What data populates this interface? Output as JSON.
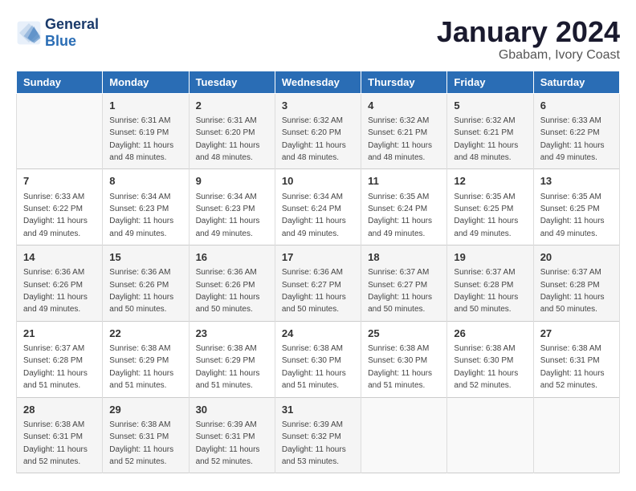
{
  "header": {
    "logo_line1": "General",
    "logo_line2": "Blue",
    "title": "January 2024",
    "subtitle": "Gbabam, Ivory Coast"
  },
  "columns": [
    "Sunday",
    "Monday",
    "Tuesday",
    "Wednesday",
    "Thursday",
    "Friday",
    "Saturday"
  ],
  "weeks": [
    [
      {
        "day": "",
        "sunrise": "",
        "sunset": "",
        "daylight": ""
      },
      {
        "day": "1",
        "sunrise": "Sunrise: 6:31 AM",
        "sunset": "Sunset: 6:19 PM",
        "daylight": "Daylight: 11 hours and 48 minutes."
      },
      {
        "day": "2",
        "sunrise": "Sunrise: 6:31 AM",
        "sunset": "Sunset: 6:20 PM",
        "daylight": "Daylight: 11 hours and 48 minutes."
      },
      {
        "day": "3",
        "sunrise": "Sunrise: 6:32 AM",
        "sunset": "Sunset: 6:20 PM",
        "daylight": "Daylight: 11 hours and 48 minutes."
      },
      {
        "day": "4",
        "sunrise": "Sunrise: 6:32 AM",
        "sunset": "Sunset: 6:21 PM",
        "daylight": "Daylight: 11 hours and 48 minutes."
      },
      {
        "day": "5",
        "sunrise": "Sunrise: 6:32 AM",
        "sunset": "Sunset: 6:21 PM",
        "daylight": "Daylight: 11 hours and 48 minutes."
      },
      {
        "day": "6",
        "sunrise": "Sunrise: 6:33 AM",
        "sunset": "Sunset: 6:22 PM",
        "daylight": "Daylight: 11 hours and 49 minutes."
      }
    ],
    [
      {
        "day": "7",
        "sunrise": "Sunrise: 6:33 AM",
        "sunset": "Sunset: 6:22 PM",
        "daylight": "Daylight: 11 hours and 49 minutes."
      },
      {
        "day": "8",
        "sunrise": "Sunrise: 6:34 AM",
        "sunset": "Sunset: 6:23 PM",
        "daylight": "Daylight: 11 hours and 49 minutes."
      },
      {
        "day": "9",
        "sunrise": "Sunrise: 6:34 AM",
        "sunset": "Sunset: 6:23 PM",
        "daylight": "Daylight: 11 hours and 49 minutes."
      },
      {
        "day": "10",
        "sunrise": "Sunrise: 6:34 AM",
        "sunset": "Sunset: 6:24 PM",
        "daylight": "Daylight: 11 hours and 49 minutes."
      },
      {
        "day": "11",
        "sunrise": "Sunrise: 6:35 AM",
        "sunset": "Sunset: 6:24 PM",
        "daylight": "Daylight: 11 hours and 49 minutes."
      },
      {
        "day": "12",
        "sunrise": "Sunrise: 6:35 AM",
        "sunset": "Sunset: 6:25 PM",
        "daylight": "Daylight: 11 hours and 49 minutes."
      },
      {
        "day": "13",
        "sunrise": "Sunrise: 6:35 AM",
        "sunset": "Sunset: 6:25 PM",
        "daylight": "Daylight: 11 hours and 49 minutes."
      }
    ],
    [
      {
        "day": "14",
        "sunrise": "Sunrise: 6:36 AM",
        "sunset": "Sunset: 6:26 PM",
        "daylight": "Daylight: 11 hours and 49 minutes."
      },
      {
        "day": "15",
        "sunrise": "Sunrise: 6:36 AM",
        "sunset": "Sunset: 6:26 PM",
        "daylight": "Daylight: 11 hours and 50 minutes."
      },
      {
        "day": "16",
        "sunrise": "Sunrise: 6:36 AM",
        "sunset": "Sunset: 6:26 PM",
        "daylight": "Daylight: 11 hours and 50 minutes."
      },
      {
        "day": "17",
        "sunrise": "Sunrise: 6:36 AM",
        "sunset": "Sunset: 6:27 PM",
        "daylight": "Daylight: 11 hours and 50 minutes."
      },
      {
        "day": "18",
        "sunrise": "Sunrise: 6:37 AM",
        "sunset": "Sunset: 6:27 PM",
        "daylight": "Daylight: 11 hours and 50 minutes."
      },
      {
        "day": "19",
        "sunrise": "Sunrise: 6:37 AM",
        "sunset": "Sunset: 6:28 PM",
        "daylight": "Daylight: 11 hours and 50 minutes."
      },
      {
        "day": "20",
        "sunrise": "Sunrise: 6:37 AM",
        "sunset": "Sunset: 6:28 PM",
        "daylight": "Daylight: 11 hours and 50 minutes."
      }
    ],
    [
      {
        "day": "21",
        "sunrise": "Sunrise: 6:37 AM",
        "sunset": "Sunset: 6:28 PM",
        "daylight": "Daylight: 11 hours and 51 minutes."
      },
      {
        "day": "22",
        "sunrise": "Sunrise: 6:38 AM",
        "sunset": "Sunset: 6:29 PM",
        "daylight": "Daylight: 11 hours and 51 minutes."
      },
      {
        "day": "23",
        "sunrise": "Sunrise: 6:38 AM",
        "sunset": "Sunset: 6:29 PM",
        "daylight": "Daylight: 11 hours and 51 minutes."
      },
      {
        "day": "24",
        "sunrise": "Sunrise: 6:38 AM",
        "sunset": "Sunset: 6:30 PM",
        "daylight": "Daylight: 11 hours and 51 minutes."
      },
      {
        "day": "25",
        "sunrise": "Sunrise: 6:38 AM",
        "sunset": "Sunset: 6:30 PM",
        "daylight": "Daylight: 11 hours and 51 minutes."
      },
      {
        "day": "26",
        "sunrise": "Sunrise: 6:38 AM",
        "sunset": "Sunset: 6:30 PM",
        "daylight": "Daylight: 11 hours and 52 minutes."
      },
      {
        "day": "27",
        "sunrise": "Sunrise: 6:38 AM",
        "sunset": "Sunset: 6:31 PM",
        "daylight": "Daylight: 11 hours and 52 minutes."
      }
    ],
    [
      {
        "day": "28",
        "sunrise": "Sunrise: 6:38 AM",
        "sunset": "Sunset: 6:31 PM",
        "daylight": "Daylight: 11 hours and 52 minutes."
      },
      {
        "day": "29",
        "sunrise": "Sunrise: 6:38 AM",
        "sunset": "Sunset: 6:31 PM",
        "daylight": "Daylight: 11 hours and 52 minutes."
      },
      {
        "day": "30",
        "sunrise": "Sunrise: 6:39 AM",
        "sunset": "Sunset: 6:31 PM",
        "daylight": "Daylight: 11 hours and 52 minutes."
      },
      {
        "day": "31",
        "sunrise": "Sunrise: 6:39 AM",
        "sunset": "Sunset: 6:32 PM",
        "daylight": "Daylight: 11 hours and 53 minutes."
      },
      {
        "day": "",
        "sunrise": "",
        "sunset": "",
        "daylight": ""
      },
      {
        "day": "",
        "sunrise": "",
        "sunset": "",
        "daylight": ""
      },
      {
        "day": "",
        "sunrise": "",
        "sunset": "",
        "daylight": ""
      }
    ]
  ]
}
